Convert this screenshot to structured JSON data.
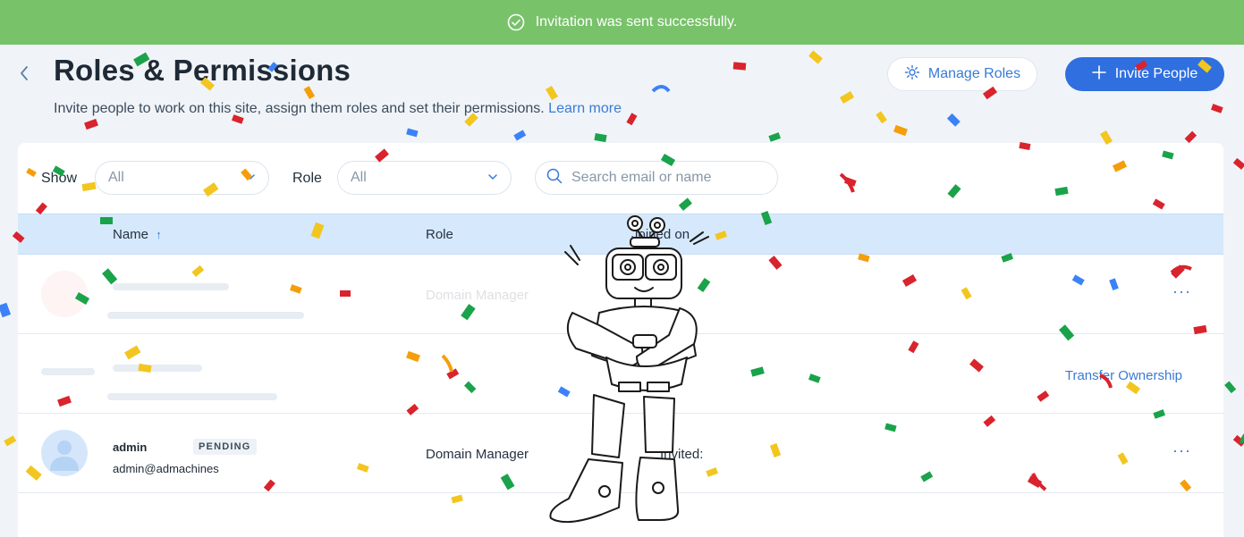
{
  "toast": {
    "message": "Invitation was sent successfully."
  },
  "header": {
    "title": "Roles & Permissions",
    "subtitle": "Invite people to work on this site, assign them roles and set their permissions.",
    "learn_more": "Learn more",
    "manage_roles": "Manage Roles",
    "invite_people": "Invite People"
  },
  "filters": {
    "show_label": "Show",
    "show_value": "All",
    "role_label": "Role",
    "role_value": "All",
    "search_placeholder": "Search email or name"
  },
  "table": {
    "columns": {
      "name": "Name",
      "role": "Role",
      "joined": "Joined on"
    },
    "rows": [
      {
        "role": "Domain Manager",
        "more": "···"
      },
      {
        "action": "Transfer Ownership"
      },
      {
        "name": "admin",
        "status": "PENDING",
        "email": "admin@admachines",
        "role": "Domain Manager",
        "joined": "Invited:",
        "more": "···"
      }
    ]
  },
  "colors": {
    "toast_bg": "#78c26a",
    "accent": "#3a7bd5",
    "primary_button": "#2f6fe0",
    "table_header": "#d6e8fb"
  }
}
